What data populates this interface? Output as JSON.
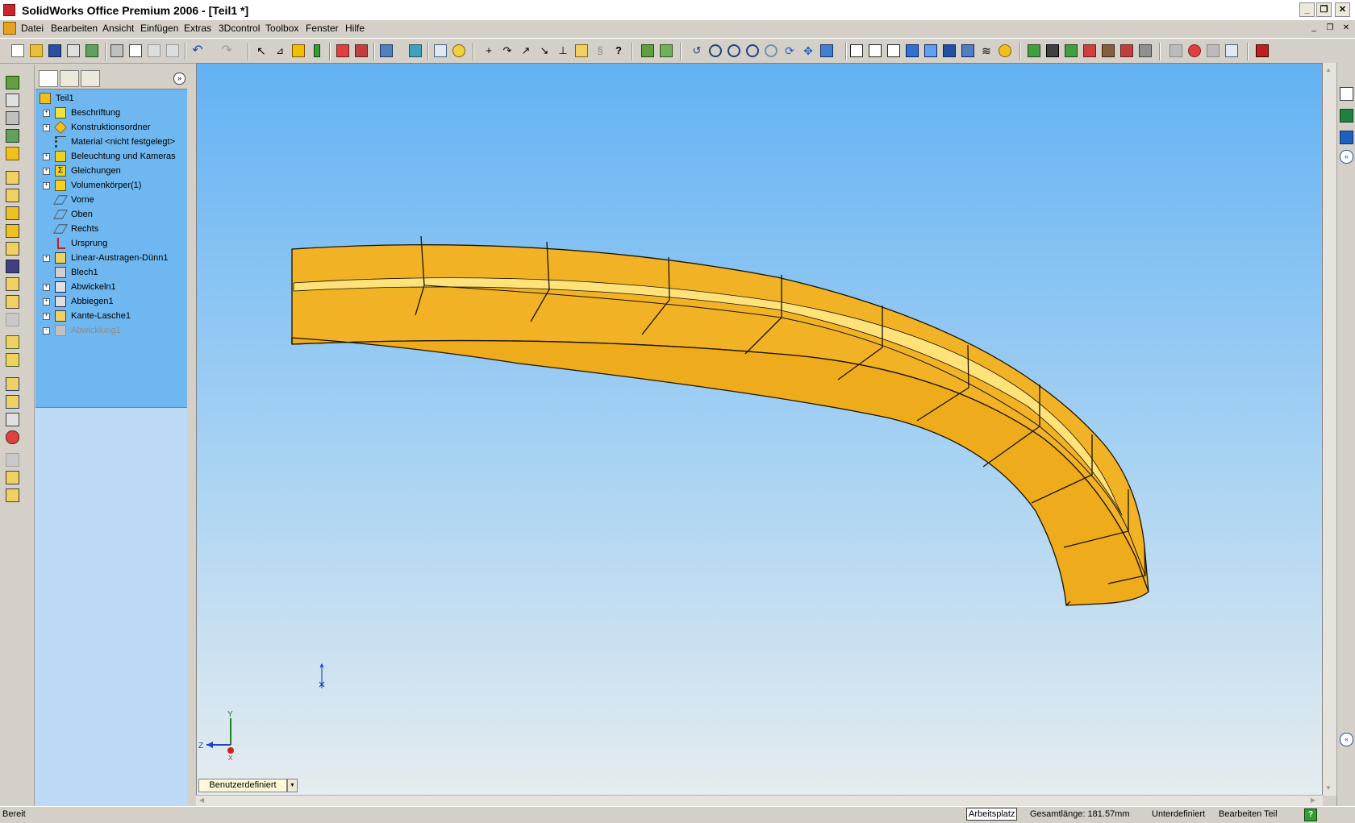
{
  "titlebar": {
    "title": "SolidWorks Office Premium 2006 - [Teil1 *]"
  },
  "menubar": {
    "items": [
      "Datei",
      "Bearbeiten",
      "Ansicht",
      "Einfügen",
      "Extras",
      "3Dcontrol",
      "Toolbox",
      "Fenster",
      "Hilfe"
    ]
  },
  "tree": {
    "root": "Teil1",
    "items": [
      {
        "label": "Beschriftung",
        "expandable": true,
        "icon": "annotation-icon"
      },
      {
        "label": "Konstruktionsordner",
        "expandable": true,
        "icon": "design-folder-icon"
      },
      {
        "label": "Material <nicht festgelegt>",
        "expandable": false,
        "icon": "material-icon"
      },
      {
        "label": "Beleuchtung und Kameras",
        "expandable": true,
        "icon": "lighting-icon"
      },
      {
        "label": "Gleichungen",
        "expandable": true,
        "icon": "equations-icon"
      },
      {
        "label": "Volumenkörper(1)",
        "expandable": true,
        "icon": "solid-bodies-icon"
      },
      {
        "label": "Vorne",
        "expandable": false,
        "icon": "plane-icon"
      },
      {
        "label": "Oben",
        "expandable": false,
        "icon": "plane-icon"
      },
      {
        "label": "Rechts",
        "expandable": false,
        "icon": "plane-icon"
      },
      {
        "label": "Ursprung",
        "expandable": false,
        "icon": "origin-icon"
      },
      {
        "label": "Linear-Austragen-Dünn1",
        "expandable": true,
        "icon": "extrude-icon"
      },
      {
        "label": "Blech1",
        "expandable": false,
        "icon": "sheetmetal-icon"
      },
      {
        "label": "Abwickeln1",
        "expandable": true,
        "icon": "unfold-icon"
      },
      {
        "label": "Abbiegen1",
        "expandable": true,
        "icon": "fold-icon"
      },
      {
        "label": "Kante-Lasche1",
        "expandable": true,
        "icon": "edge-flange-icon"
      },
      {
        "label": "Abwicklung1",
        "expandable": true,
        "icon": "flat-pattern-icon",
        "suppressed": true
      }
    ]
  },
  "viewport": {
    "view_name": "Benutzerdefiniert",
    "triad": {
      "x": "X",
      "y": "Y",
      "z": "Z"
    },
    "part_color": "#f0b020"
  },
  "statusbar": {
    "status": "Bereit",
    "workspace": "Arbeitsplatz",
    "total_length": "Gesamtlänge: 181.57mm",
    "definition": "Unterdefiniert",
    "mode": "Bearbeiten Teil"
  }
}
